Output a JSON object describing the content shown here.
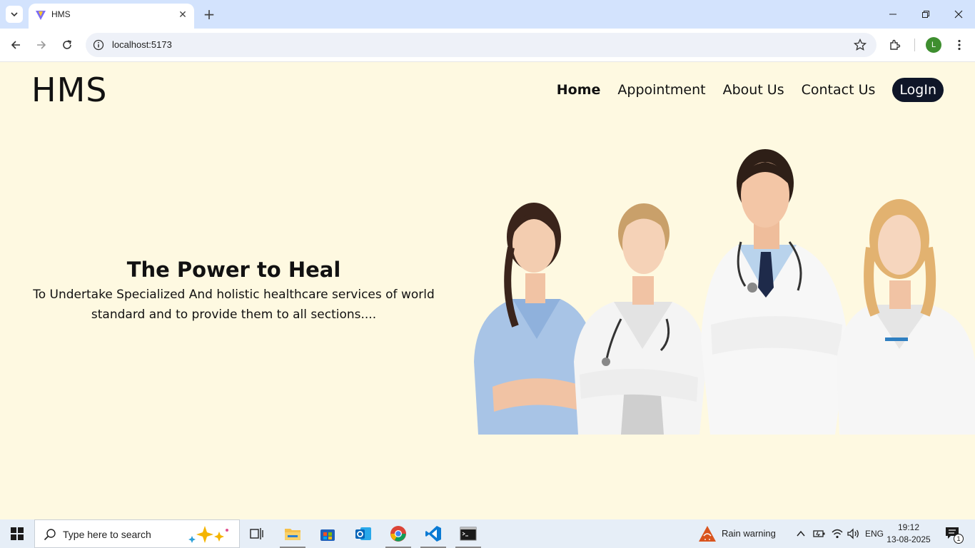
{
  "browser": {
    "tab_title": "HMS",
    "url": "localhost:5173",
    "profile_initial": "L"
  },
  "site": {
    "logo": "HMS",
    "nav": {
      "home": "Home",
      "appointment": "Appointment",
      "about": "About Us",
      "contact": "Contact Us",
      "login": "LogIn"
    },
    "hero": {
      "title": "The Power to Heal",
      "subtitle": "To Undertake Specialized And holistic healthcare services of world standard and to provide them to all sections...."
    },
    "colors": {
      "page_bg": "#fef9e1",
      "login_bg": "#0f1628"
    }
  },
  "taskbar": {
    "search_placeholder": "Type here to search",
    "weather": "Rain warning",
    "language": "ENG",
    "time": "19:12",
    "date": "13-08-2025",
    "notification_count": "1"
  }
}
